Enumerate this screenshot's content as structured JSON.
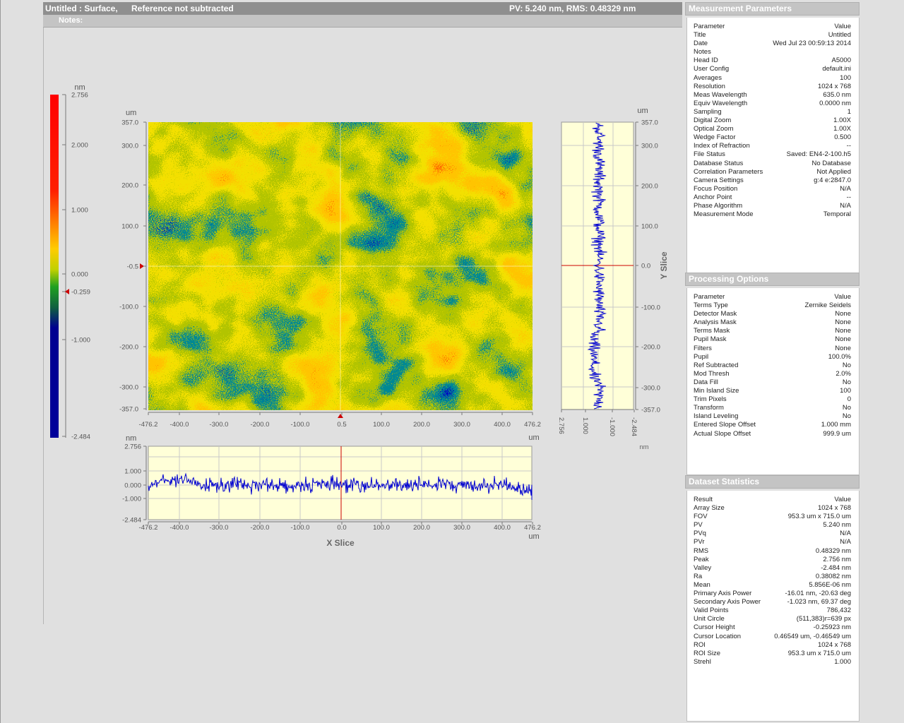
{
  "title_bar": {
    "title": "Untitled : Surface,",
    "reference": "Reference not subtracted",
    "summary": "PV: 5.240 nm, RMS: 0.48329 nm"
  },
  "notes_label": "Notes:",
  "colorbar": {
    "unit": "nm",
    "ticks": [
      "2.756",
      "2.000",
      "1.000",
      "0.000",
      "-0.259",
      "-1.000",
      "-2.484"
    ]
  },
  "surface_map": {
    "x_unit": "um",
    "y_unit": "um",
    "y_ticks": [
      "357.0",
      "300.0",
      "200.0",
      "100.0",
      "-0.5",
      "-100.0",
      "-200.0",
      "-300.0",
      "-357.0"
    ],
    "x_ticks": [
      "-476.2",
      "-400.0",
      "-300.0",
      "-200.0",
      "-100.0",
      "0.5",
      "100.0",
      "200.0",
      "300.0",
      "400.0",
      "476.2"
    ]
  },
  "y_slice": {
    "label": "Y Slice",
    "unit_top": "um",
    "unit_bottom": "nm",
    "y_ticks": [
      "357.0",
      "300.0",
      "200.0",
      "100.0",
      "0.0",
      "-100.0",
      "-200.0",
      "-300.0",
      "-357.0"
    ],
    "value_ticks": [
      "2.756",
      "1.000",
      "-1.000",
      "-2.484"
    ]
  },
  "x_slice": {
    "label": "X Slice",
    "unit_left": "nm",
    "unit_right_top": "um",
    "unit_right_bottom": "um",
    "value_ticks": [
      "2.756",
      "1.000",
      "0.000",
      "-1.000",
      "-2.484"
    ],
    "x_ticks": [
      "-476.2",
      "-400.0",
      "-300.0",
      "-200.0",
      "-100.0",
      "0.0",
      "100.0",
      "200.0",
      "300.0",
      "400.0",
      "476.2"
    ]
  },
  "colors": {
    "plot_bg": "#ffffd8",
    "trace": "#0000d0",
    "cursor": "#cc0000"
  },
  "measurement_parameters": {
    "title": "Measurement Parameters",
    "header": {
      "k": "Parameter",
      "v": "Value"
    },
    "rows": [
      {
        "k": "Title",
        "v": "Untitled"
      },
      {
        "k": "Date",
        "v": "Wed Jul 23 00:59:13 2014"
      },
      {
        "k": "Notes",
        "v": ""
      },
      {
        "k": "Head ID",
        "v": "A5000"
      },
      {
        "k": "User Config",
        "v": "default.ini"
      },
      {
        "k": "Averages",
        "v": "100"
      },
      {
        "k": "Resolution",
        "v": "1024 x 768"
      },
      {
        "k": "Meas Wavelength",
        "v": "635.0 nm"
      },
      {
        "k": "Equiv Wavelength",
        "v": "0.0000 nm"
      },
      {
        "k": "Sampling",
        "v": "1"
      },
      {
        "k": "Digital Zoom",
        "v": "1.00X"
      },
      {
        "k": "Optical Zoom",
        "v": "1.00X"
      },
      {
        "k": "Wedge Factor",
        "v": "0.500"
      },
      {
        "k": "Index of Refraction",
        "v": "--"
      },
      {
        "k": "File Status",
        "v": "Saved: EN4-2-100.h5"
      },
      {
        "k": "Database Status",
        "v": "No Database"
      },
      {
        "k": "Correlation Parameters",
        "v": "Not Applied"
      },
      {
        "k": "Camera Settings",
        "v": "g:4 e:2847.0"
      },
      {
        "k": "Focus Position",
        "v": "N/A"
      },
      {
        "k": "Anchor Point",
        "v": "--"
      },
      {
        "k": "Phase Algorithm",
        "v": "N/A"
      },
      {
        "k": "Measurement Mode",
        "v": "Temporal"
      }
    ]
  },
  "processing_options": {
    "title": "Processing Options",
    "header": {
      "k": "Parameter",
      "v": "Value"
    },
    "rows": [
      {
        "k": "Terms Type",
        "v": "Zernike Seidels"
      },
      {
        "k": "Detector Mask",
        "v": "None"
      },
      {
        "k": "Analysis Mask",
        "v": "None"
      },
      {
        "k": "Terms Mask",
        "v": "None"
      },
      {
        "k": "Pupil Mask",
        "v": "None"
      },
      {
        "k": "Filters",
        "v": "None"
      },
      {
        "k": "Pupil",
        "v": "100.0%"
      },
      {
        "k": "Ref Subtracted",
        "v": "No"
      },
      {
        "k": "Mod Thresh",
        "v": "2.0%"
      },
      {
        "k": "Data Fill",
        "v": "No"
      },
      {
        "k": "Min Island Size",
        "v": "100"
      },
      {
        "k": "Trim Pixels",
        "v": "0"
      },
      {
        "k": "Transform",
        "v": "No"
      },
      {
        "k": "Island Leveling",
        "v": "No"
      },
      {
        "k": "Entered Slope Offset",
        "v": "1.000 mm"
      },
      {
        "k": "Actual Slope Offset",
        "v": "999.9 um"
      }
    ]
  },
  "dataset_statistics": {
    "title": "Dataset Statistics",
    "header": {
      "k": "Result",
      "v": "Value"
    },
    "rows": [
      {
        "k": "Array Size",
        "v": "1024 x 768"
      },
      {
        "k": "FOV",
        "v": "953.3 um x 715.0 um"
      },
      {
        "k": "PV",
        "v": "5.240 nm"
      },
      {
        "k": "PVq",
        "v": "N/A"
      },
      {
        "k": "PVr",
        "v": "N/A"
      },
      {
        "k": "RMS",
        "v": "0.48329 nm"
      },
      {
        "k": "Peak",
        "v": "2.756 nm"
      },
      {
        "k": "Valley",
        "v": "-2.484 nm"
      },
      {
        "k": "Ra",
        "v": "0.38082 nm"
      },
      {
        "k": "Mean",
        "v": "5.856E-06 nm"
      },
      {
        "k": "Primary Axis Power",
        "v": "-16.01 nm, -20.63 deg"
      },
      {
        "k": "Secondary Axis Power",
        "v": "-1.023 nm, 69.37 deg"
      },
      {
        "k": "Valid Points",
        "v": "786,432"
      },
      {
        "k": "Unit Circle",
        "v": "(511,383)r=639 px"
      },
      {
        "k": "Cursor Height",
        "v": "-0.25923 nm"
      },
      {
        "k": "Cursor Location",
        "v": "0.46549 um, -0.46549 um"
      },
      {
        "k": "ROI",
        "v": "1024 x 768"
      },
      {
        "k": "ROI Size",
        "v": "953.3 um x 715.0 um"
      },
      {
        "k": "Strehl",
        "v": "1.000"
      }
    ]
  }
}
